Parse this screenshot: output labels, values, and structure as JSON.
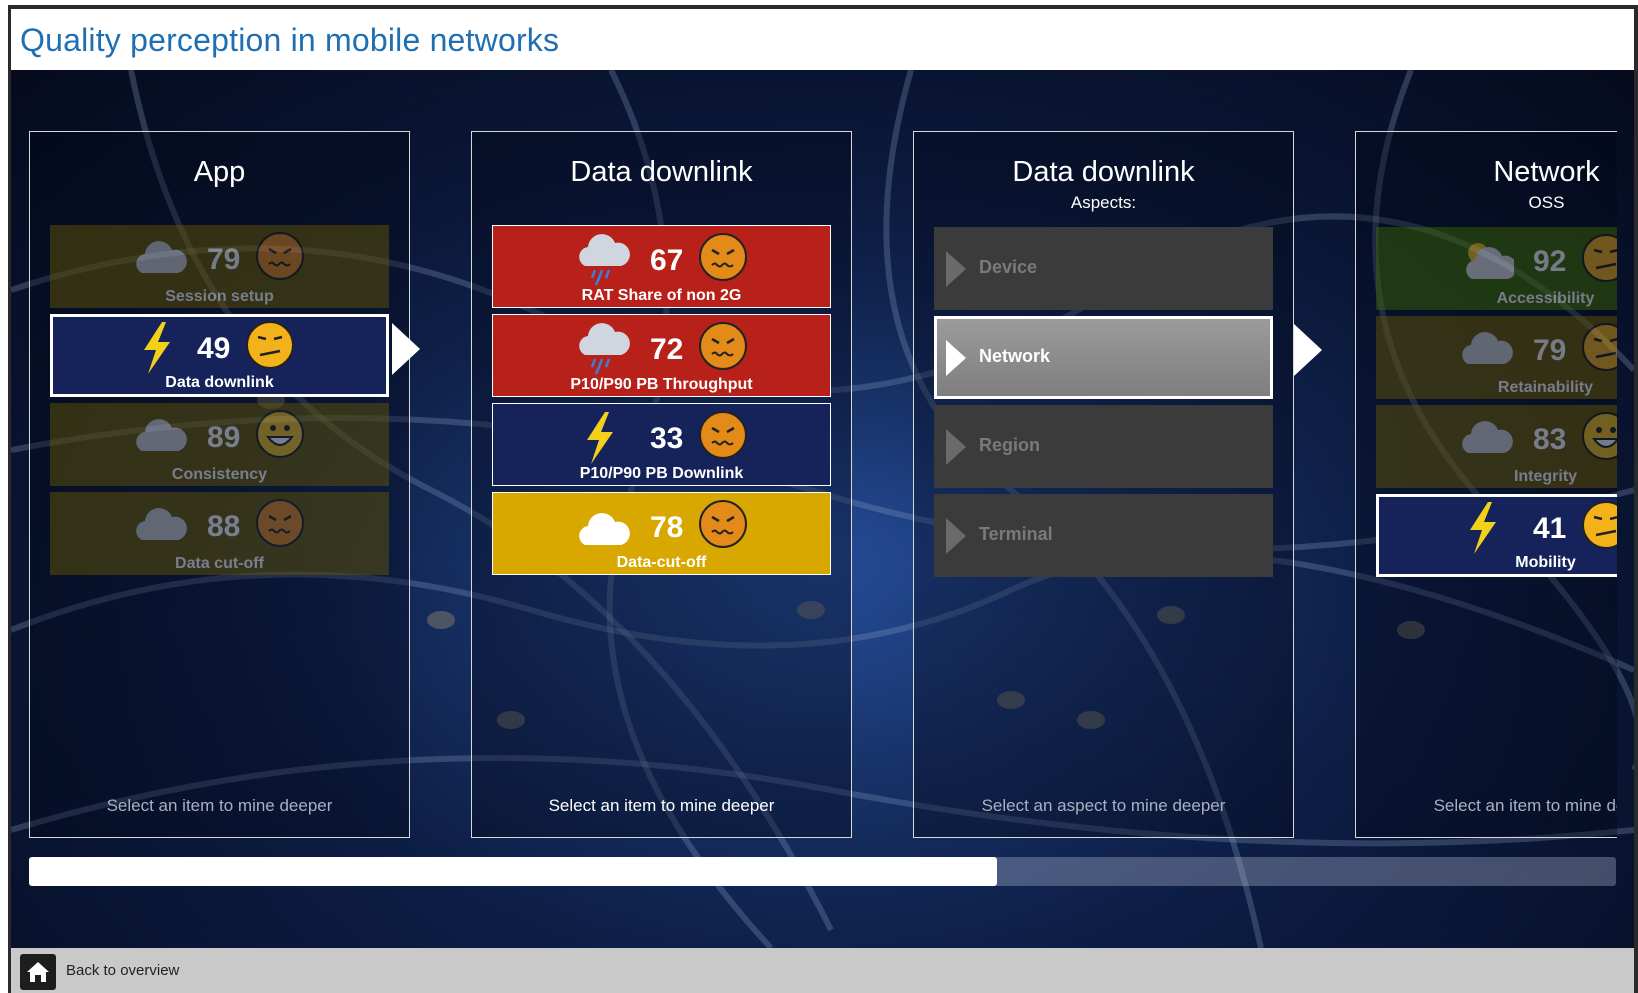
{
  "title": "Quality perception in mobile networks",
  "panels": [
    {
      "title": "App",
      "subtitle": "",
      "hint": "Select an item to mine deeper",
      "tiles": [
        {
          "value": "79",
          "label": "Session setup",
          "color": "#6b5a00",
          "weather": "cloud-icon",
          "face": "angry-face-icon",
          "state": "dim"
        },
        {
          "value": "49",
          "label": "Data downlink",
          "color": "#16235a",
          "weather": "lightning-icon",
          "face": "skeptical-face-icon",
          "state": "selected"
        },
        {
          "value": "89",
          "label": "Consistency",
          "color": "#6b5a00",
          "weather": "cloud-icon",
          "face": "happy-face-icon",
          "state": "dim"
        },
        {
          "value": "88",
          "label": "Data cut-off",
          "color": "#6b5a00",
          "weather": "cloud-icon",
          "face": "angry-face-icon",
          "state": "dim"
        }
      ]
    },
    {
      "title": "Data downlink",
      "subtitle": "",
      "hint": "Select an item to mine deeper",
      "tiles": [
        {
          "value": "67",
          "label": "RAT Share of non 2G",
          "color": "#b8211a",
          "weather": "rain-cloud-icon",
          "face": "angry-face-icon",
          "state": "normal"
        },
        {
          "value": "72",
          "label": "P10/P90 PB Throughput",
          "color": "#b8211a",
          "weather": "rain-cloud-icon",
          "face": "angry-face-icon",
          "state": "normal"
        },
        {
          "value": "33",
          "label": "P10/P90 PB Downlink",
          "color": "#16235a",
          "weather": "lightning-icon",
          "face": "angry-face-icon",
          "state": "normal"
        },
        {
          "value": "78",
          "label": "Data-cut-off",
          "color": "#d9a800",
          "weather": "cloud-icon",
          "face": "angry-face-icon",
          "state": "normal"
        }
      ]
    },
    {
      "title": "Data downlink",
      "subtitle": "Aspects:",
      "hint": "Select an aspect to mine deeper",
      "aspects": [
        {
          "label": "Device",
          "state": "normal"
        },
        {
          "label": "Network",
          "state": "selected"
        },
        {
          "label": "Region",
          "state": "normal"
        },
        {
          "label": "Terminal",
          "state": "normal"
        }
      ]
    },
    {
      "title": "Network",
      "subtitle": "OSS",
      "hint": "Select an item to mine deeper",
      "tiles": [
        {
          "value": "92",
          "label": "Accessibility",
          "color": "#3e6b00",
          "weather": "sun-cloud-icon",
          "face": "skeptical-face-icon",
          "state": "dim"
        },
        {
          "value": "79",
          "label": "Retainability",
          "color": "#6b5a00",
          "weather": "cloud-icon",
          "face": "skeptical-face-icon",
          "state": "dim"
        },
        {
          "value": "83",
          "label": "Integrity",
          "color": "#6b5a00",
          "weather": "cloud-icon",
          "face": "happy-face-icon",
          "state": "dim"
        },
        {
          "value": "41",
          "label": "Mobility",
          "color": "#16235a",
          "weather": "lightning-icon",
          "face": "skeptical-face-icon",
          "state": "selected"
        }
      ]
    }
  ],
  "scroll": {
    "position_fraction": 0.61
  },
  "footer": {
    "back_label": "Back to overview",
    "icon": "home-icon"
  }
}
